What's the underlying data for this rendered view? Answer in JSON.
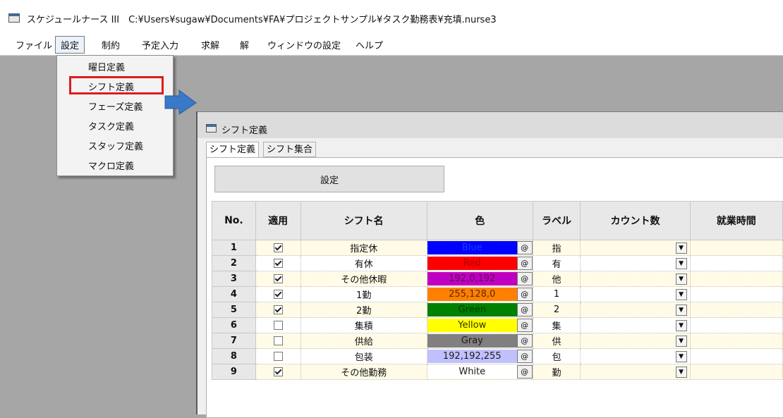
{
  "app": {
    "title": "スケジュールナース III　C:¥Users¥sugaw¥Documents¥FA¥プロジェクトサンプル¥タスク勤務表¥充填.nurse3"
  },
  "menu": {
    "items": [
      "ファイル",
      "設定",
      "制約",
      "予定入力",
      "求解",
      "解",
      "ウィンドウの設定",
      "ヘルプ"
    ]
  },
  "dropdown": {
    "items": [
      "曜日定義",
      "シフト定義",
      "フェーズ定義",
      "タスク定義",
      "スタッフ定義",
      "マクロ定義"
    ]
  },
  "child": {
    "title": "シフト定義",
    "tabs": [
      "シフト定義",
      "シフト集合"
    ],
    "button": "設定"
  },
  "grid": {
    "headers": [
      "No.",
      "適用",
      "シフト名",
      "色",
      "ラベル",
      "カウント数",
      "就業時間"
    ],
    "rows": [
      {
        "no": "1",
        "checked": true,
        "name": "指定休",
        "color_text": "Blue",
        "color": "#0000ff",
        "text_color": "#1a3cff",
        "label": "指"
      },
      {
        "no": "2",
        "checked": true,
        "name": "有休",
        "color_text": "Red",
        "color": "#ff0000",
        "text_color": "#b00000",
        "label": "有"
      },
      {
        "no": "3",
        "checked": true,
        "name": "その他休暇",
        "color_text": "192,0,192",
        "color": "#c000c0",
        "text_color": "#5a005a",
        "label": "他"
      },
      {
        "no": "4",
        "checked": true,
        "name": "1勤",
        "color_text": "255,128,0",
        "color": "#ff8000",
        "text_color": "#5a2a00",
        "label": "1"
      },
      {
        "no": "5",
        "checked": true,
        "name": "2勤",
        "color_text": "Green",
        "color": "#008000",
        "text_color": "#003a00",
        "label": "2"
      },
      {
        "no": "6",
        "checked": false,
        "name": "集積",
        "color_text": "Yellow",
        "color": "#ffff00",
        "text_color": "#333300",
        "label": "集"
      },
      {
        "no": "7",
        "checked": false,
        "name": "供給",
        "color_text": "Gray",
        "color": "#808080",
        "text_color": "#1a1a1a",
        "label": "供"
      },
      {
        "no": "8",
        "checked": false,
        "name": "包装",
        "color_text": "192,192,255",
        "color": "#c0c0ff",
        "text_color": "#1a1a1a",
        "label": "包"
      },
      {
        "no": "9",
        "checked": true,
        "name": "その他勤務",
        "color_text": "White",
        "color": "#ffffff",
        "text_color": "#1a1a1a",
        "label": "勤"
      }
    ]
  }
}
